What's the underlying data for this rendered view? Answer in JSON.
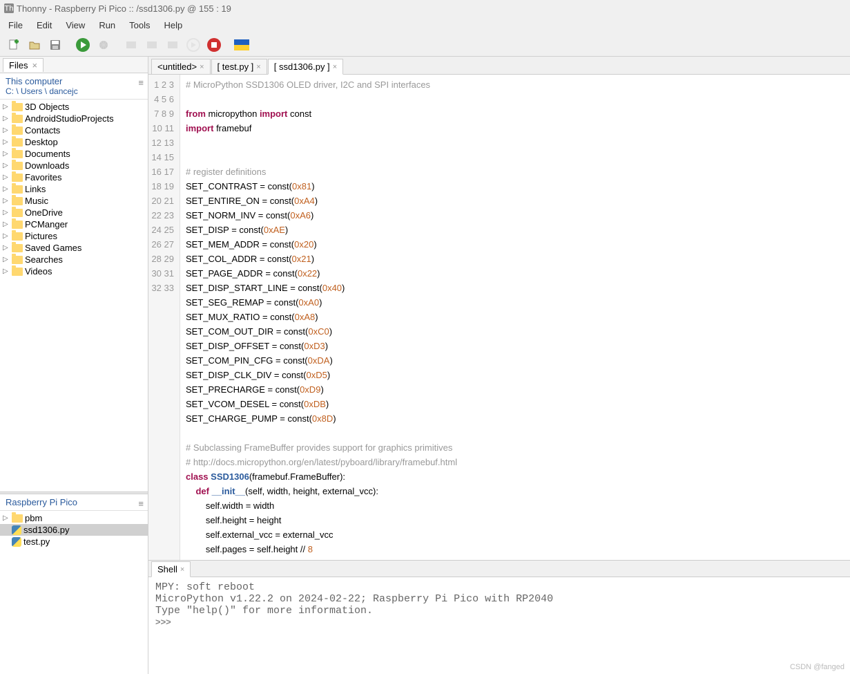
{
  "title": "Thonny  -  Raspberry Pi Pico :: /ssd1306.py  @  155 : 19",
  "menu": [
    "File",
    "Edit",
    "View",
    "Run",
    "Tools",
    "Help"
  ],
  "files_panel": {
    "tab": "Files",
    "header_title": "This computer",
    "header_path": "C: \\ Users \\ dancejc",
    "items": [
      "3D Objects",
      "AndroidStudioProjects",
      "Contacts",
      "Desktop",
      "Documents",
      "Downloads",
      "Favorites",
      "Links",
      "Music",
      "OneDrive",
      "PCManger",
      "Pictures",
      "Saved Games",
      "Searches",
      "Videos"
    ]
  },
  "device_panel": {
    "title": "Raspberry Pi Pico",
    "items": [
      {
        "name": "pbm",
        "type": "folder"
      },
      {
        "name": "ssd1306.py",
        "type": "py",
        "selected": true
      },
      {
        "name": "test.py",
        "type": "py"
      }
    ]
  },
  "tabs": [
    {
      "label": "<untitled>",
      "active": false
    },
    {
      "label": "[ test.py ]",
      "active": false
    },
    {
      "label": "[ ssd1306.py ]",
      "active": true
    }
  ],
  "code_lines": [
    {
      "n": 1,
      "h": "<span class='c'># MicroPython SSD1306 OLED driver, I2C and SPI interfaces</span>"
    },
    {
      "n": 2,
      "h": ""
    },
    {
      "n": 3,
      "h": "<span class='k'>from</span> micropython <span class='k'>import</span> const"
    },
    {
      "n": 4,
      "h": "<span class='k'>import</span> framebuf"
    },
    {
      "n": 5,
      "h": ""
    },
    {
      "n": 6,
      "h": ""
    },
    {
      "n": 7,
      "h": "<span class='c'># register definitions</span>"
    },
    {
      "n": 8,
      "h": "SET_CONTRAST = const(<span class='n'>0x81</span>)"
    },
    {
      "n": 9,
      "h": "SET_ENTIRE_ON = const(<span class='n'>0xA4</span>)"
    },
    {
      "n": 10,
      "h": "SET_NORM_INV = const(<span class='n'>0xA6</span>)"
    },
    {
      "n": 11,
      "h": "SET_DISP = const(<span class='n'>0xAE</span>)"
    },
    {
      "n": 12,
      "h": "SET_MEM_ADDR = const(<span class='n'>0x20</span>)"
    },
    {
      "n": 13,
      "h": "SET_COL_ADDR = const(<span class='n'>0x21</span>)"
    },
    {
      "n": 14,
      "h": "SET_PAGE_ADDR = const(<span class='n'>0x22</span>)"
    },
    {
      "n": 15,
      "h": "SET_DISP_START_LINE = const(<span class='n'>0x40</span>)"
    },
    {
      "n": 16,
      "h": "SET_SEG_REMAP = const(<span class='n'>0xA0</span>)"
    },
    {
      "n": 17,
      "h": "SET_MUX_RATIO = const(<span class='n'>0xA8</span>)"
    },
    {
      "n": 18,
      "h": "SET_COM_OUT_DIR = const(<span class='n'>0xC0</span>)"
    },
    {
      "n": 19,
      "h": "SET_DISP_OFFSET = const(<span class='n'>0xD3</span>)"
    },
    {
      "n": 20,
      "h": "SET_COM_PIN_CFG = const(<span class='n'>0xDA</span>)"
    },
    {
      "n": 21,
      "h": "SET_DISP_CLK_DIV = const(<span class='n'>0xD5</span>)"
    },
    {
      "n": 22,
      "h": "SET_PRECHARGE = const(<span class='n'>0xD9</span>)"
    },
    {
      "n": 23,
      "h": "SET_VCOM_DESEL = const(<span class='n'>0xDB</span>)"
    },
    {
      "n": 24,
      "h": "SET_CHARGE_PUMP = const(<span class='n'>0x8D</span>)"
    },
    {
      "n": 25,
      "h": ""
    },
    {
      "n": 26,
      "h": "<span class='c'># Subclassing FrameBuffer provides support for graphics primitives</span>"
    },
    {
      "n": 27,
      "h": "<span class='c'># http://docs.micropython.org/en/latest/pyboard/library/framebuf.html</span>"
    },
    {
      "n": 28,
      "h": "<span class='k'>class</span> <span class='d'>SSD1306</span>(framebuf.FrameBuffer):"
    },
    {
      "n": 29,
      "h": "    <span class='k'>def</span> <span class='d'>__init__</span>(<span class='s'>self</span>, width, height, external_vcc):"
    },
    {
      "n": 30,
      "h": "        <span class='s'>self</span>.width = width"
    },
    {
      "n": 31,
      "h": "        <span class='s'>self</span>.height = height"
    },
    {
      "n": 32,
      "h": "        <span class='s'>self</span>.external_vcc = external_vcc"
    },
    {
      "n": 33,
      "h": "        <span class='s'>self</span>.pages = <span class='s'>self</span>.height // <span class='n'>8</span>"
    }
  ],
  "shell": {
    "tab": "Shell",
    "lines": [
      " MPY: soft reboot",
      "MicroPython v1.22.2 on 2024-02-22; Raspberry Pi Pico with RP2040",
      "Type \"help()\" for more information."
    ],
    "prompt": ">>> "
  },
  "watermark": "CSDN @fanged"
}
